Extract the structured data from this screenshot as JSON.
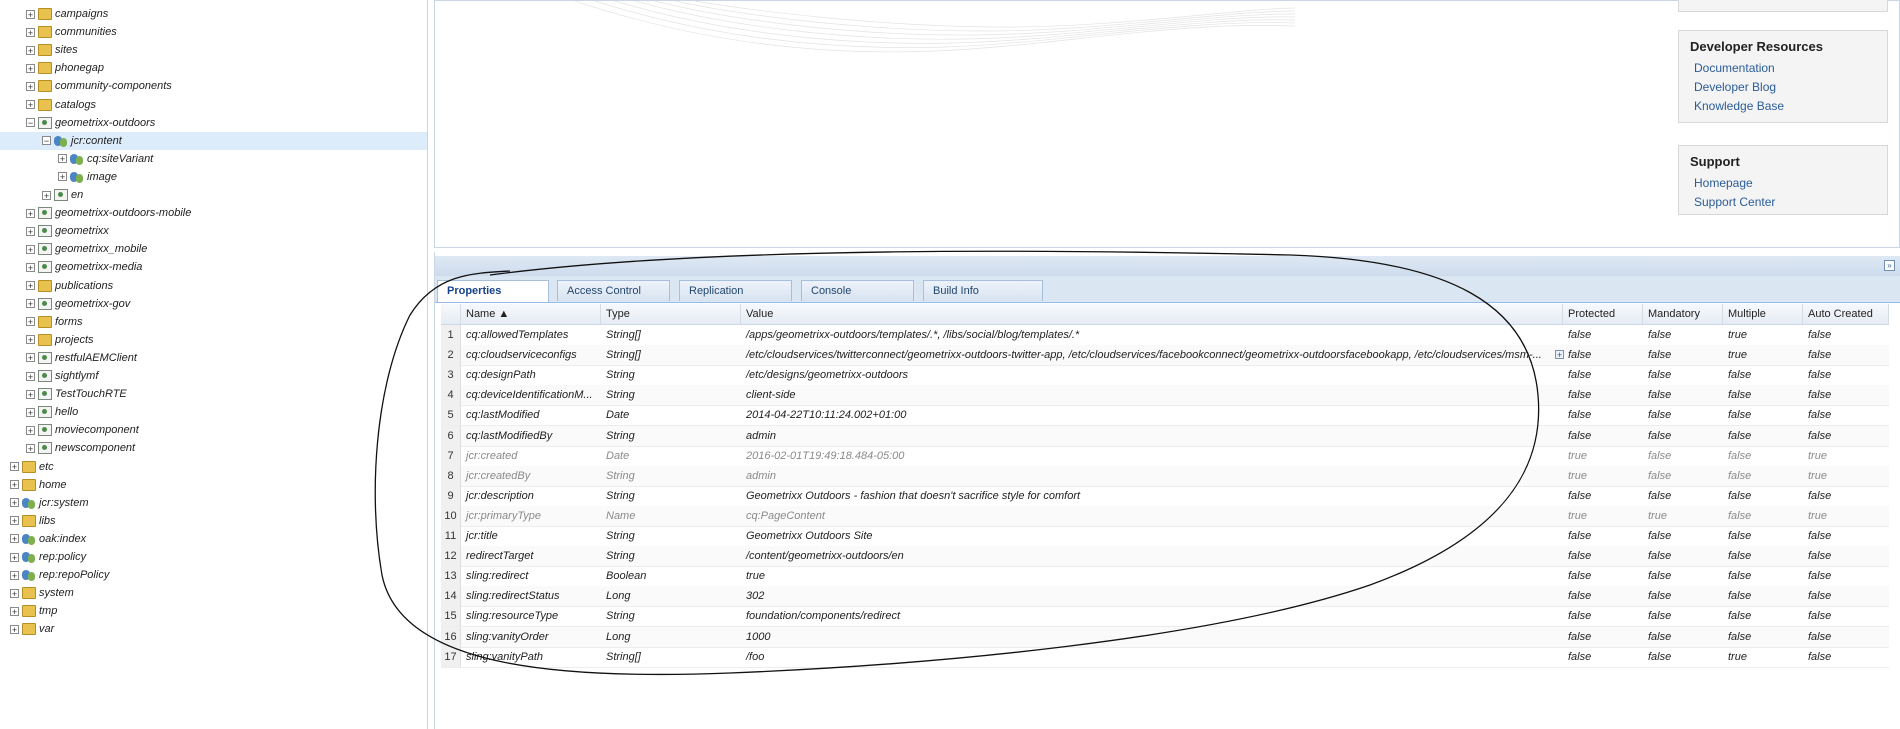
{
  "tree": {
    "nodes": [
      {
        "label": "campaigns",
        "depth": 1,
        "icon": "folder",
        "toggle": "+"
      },
      {
        "label": "communities",
        "depth": 1,
        "icon": "folder",
        "toggle": "+"
      },
      {
        "label": "sites",
        "depth": 1,
        "icon": "folder",
        "toggle": "+"
      },
      {
        "label": "phonegap",
        "depth": 1,
        "icon": "folder",
        "toggle": "+"
      },
      {
        "label": "community-components",
        "depth": 1,
        "icon": "folder",
        "toggle": "+"
      },
      {
        "label": "catalogs",
        "depth": 1,
        "icon": "folder",
        "toggle": "+"
      },
      {
        "label": "geometrixx-outdoors",
        "depth": 1,
        "icon": "page",
        "toggle": "−"
      },
      {
        "label": "jcr:content",
        "depth": 2,
        "icon": "people",
        "toggle": "−",
        "selected": true
      },
      {
        "label": "cq:siteVariant",
        "depth": 3,
        "icon": "people",
        "toggle": "+"
      },
      {
        "label": "image",
        "depth": 3,
        "icon": "people",
        "toggle": "+"
      },
      {
        "label": "en",
        "depth": 2,
        "icon": "page",
        "toggle": "+"
      },
      {
        "label": "geometrixx-outdoors-mobile",
        "depth": 1,
        "icon": "page",
        "toggle": "+"
      },
      {
        "label": "geometrixx",
        "depth": 1,
        "icon": "page",
        "toggle": "+"
      },
      {
        "label": "geometrixx_mobile",
        "depth": 1,
        "icon": "page",
        "toggle": "+"
      },
      {
        "label": "geometrixx-media",
        "depth": 1,
        "icon": "page",
        "toggle": "+"
      },
      {
        "label": "publications",
        "depth": 1,
        "icon": "folder",
        "toggle": "+"
      },
      {
        "label": "geometrixx-gov",
        "depth": 1,
        "icon": "page",
        "toggle": "+"
      },
      {
        "label": "forms",
        "depth": 1,
        "icon": "folder",
        "toggle": "+"
      },
      {
        "label": "projects",
        "depth": 1,
        "icon": "folder",
        "toggle": "+"
      },
      {
        "label": "restfulAEMClient",
        "depth": 1,
        "icon": "page",
        "toggle": "+"
      },
      {
        "label": "sightlymf",
        "depth": 1,
        "icon": "page",
        "toggle": "+"
      },
      {
        "label": "TestTouchRTE",
        "depth": 1,
        "icon": "page",
        "toggle": "+"
      },
      {
        "label": "hello",
        "depth": 1,
        "icon": "page",
        "toggle": "+"
      },
      {
        "label": "moviecomponent",
        "depth": 1,
        "icon": "page",
        "toggle": "+"
      },
      {
        "label": "newscomponent",
        "depth": 1,
        "icon": "page",
        "toggle": "+"
      },
      {
        "label": "etc",
        "depth": 0,
        "icon": "folder",
        "toggle": "+"
      },
      {
        "label": "home",
        "depth": 0,
        "icon": "folder",
        "toggle": "+"
      },
      {
        "label": "jcr:system",
        "depth": 0,
        "icon": "people",
        "toggle": "+"
      },
      {
        "label": "libs",
        "depth": 0,
        "icon": "folder",
        "toggle": "+"
      },
      {
        "label": "oak:index",
        "depth": 0,
        "icon": "people",
        "toggle": "+"
      },
      {
        "label": "rep:policy",
        "depth": 0,
        "icon": "people",
        "toggle": "+"
      },
      {
        "label": "rep:repoPolicy",
        "depth": 0,
        "icon": "people",
        "toggle": "+"
      },
      {
        "label": "system",
        "depth": 0,
        "icon": "folder",
        "toggle": "+"
      },
      {
        "label": "tmp",
        "depth": 0,
        "icon": "folder",
        "toggle": "+"
      },
      {
        "label": "var",
        "depth": 0,
        "icon": "folder",
        "toggle": "+"
      }
    ]
  },
  "sidebar_right": {
    "developer": {
      "title": "Developer Resources",
      "links": [
        "Documentation",
        "Developer Blog",
        "Knowledge Base"
      ]
    },
    "support": {
      "title": "Support",
      "links": [
        "Homepage",
        "Support Center"
      ]
    }
  },
  "tabs": [
    "Properties",
    "Access Control",
    "Replication",
    "Console",
    "Build Info"
  ],
  "active_tab": "Properties",
  "columns": [
    "Name ▲",
    "Type",
    "Value",
    "Protected",
    "Mandatory",
    "Multiple",
    "Auto Created"
  ],
  "rows": [
    {
      "n": "1",
      "name": "cq:allowedTemplates",
      "type": "String[]",
      "value": "/apps/geometrixx-outdoors/templates/.*, /libs/social/blog/templates/.*",
      "protected": "false",
      "mandatory": "false",
      "multiple": "true",
      "auto": "false"
    },
    {
      "n": "2",
      "name": "cq:cloudserviceconfigs",
      "type": "String[]",
      "value": "/etc/cloudservices/twitterconnect/geometrixx-outdoors-twitter-app, /etc/cloudservices/facebookconnect/geometrixx-outdoorsfacebookapp, /etc/cloudservices/msm-...",
      "protected": "false",
      "mandatory": "false",
      "multiple": "true",
      "auto": "false",
      "expand": true
    },
    {
      "n": "3",
      "name": "cq:designPath",
      "type": "String",
      "value": "/etc/designs/geometrixx-outdoors",
      "protected": "false",
      "mandatory": "false",
      "multiple": "false",
      "auto": "false"
    },
    {
      "n": "4",
      "name": "cq:deviceIdentificationM...",
      "type": "String",
      "value": "client-side",
      "protected": "false",
      "mandatory": "false",
      "multiple": "false",
      "auto": "false"
    },
    {
      "n": "5",
      "name": "cq:lastModified",
      "type": "Date",
      "value": "2014-04-22T10:11:24.002+01:00",
      "protected": "false",
      "mandatory": "false",
      "multiple": "false",
      "auto": "false"
    },
    {
      "n": "6",
      "name": "cq:lastModifiedBy",
      "type": "String",
      "value": "admin",
      "protected": "false",
      "mandatory": "false",
      "multiple": "false",
      "auto": "false"
    },
    {
      "n": "7",
      "name": "jcr:created",
      "type": "Date",
      "value": "2016-02-01T19:49:18.484-05:00",
      "protected": "true",
      "mandatory": "false",
      "multiple": "false",
      "auto": "true",
      "isProtected": true
    },
    {
      "n": "8",
      "name": "jcr:createdBy",
      "type": "String",
      "value": "admin",
      "protected": "true",
      "mandatory": "false",
      "multiple": "false",
      "auto": "true",
      "isProtected": true
    },
    {
      "n": "9",
      "name": "jcr:description",
      "type": "String",
      "value": "Geometrixx Outdoors - fashion that doesn't sacrifice style for comfort",
      "protected": "false",
      "mandatory": "false",
      "multiple": "false",
      "auto": "false"
    },
    {
      "n": "10",
      "name": "jcr:primaryType",
      "type": "Name",
      "value": "cq:PageContent",
      "protected": "true",
      "mandatory": "true",
      "multiple": "false",
      "auto": "true",
      "isProtected": true
    },
    {
      "n": "11",
      "name": "jcr:title",
      "type": "String",
      "value": "Geometrixx Outdoors Site",
      "protected": "false",
      "mandatory": "false",
      "multiple": "false",
      "auto": "false"
    },
    {
      "n": "12",
      "name": "redirectTarget",
      "type": "String",
      "value": "/content/geometrixx-outdoors/en",
      "protected": "false",
      "mandatory": "false",
      "multiple": "false",
      "auto": "false"
    },
    {
      "n": "13",
      "name": "sling:redirect",
      "type": "Boolean",
      "value": "true",
      "protected": "false",
      "mandatory": "false",
      "multiple": "false",
      "auto": "false"
    },
    {
      "n": "14",
      "name": "sling:redirectStatus",
      "type": "Long",
      "value": "302",
      "protected": "false",
      "mandatory": "false",
      "multiple": "false",
      "auto": "false"
    },
    {
      "n": "15",
      "name": "sling:resourceType",
      "type": "String",
      "value": "foundation/components/redirect",
      "protected": "false",
      "mandatory": "false",
      "multiple": "false",
      "auto": "false"
    },
    {
      "n": "16",
      "name": "sling:vanityOrder",
      "type": "Long",
      "value": "1000",
      "protected": "false",
      "mandatory": "false",
      "multiple": "false",
      "auto": "false"
    },
    {
      "n": "17",
      "name": "sling:vanityPath",
      "type": "String[]",
      "value": "/foo",
      "protected": "false",
      "mandatory": "false",
      "multiple": "true",
      "auto": "false"
    }
  ],
  "colors": {
    "accent": "#15428b",
    "link": "#2a5c98",
    "selected": "#dcecfb"
  }
}
